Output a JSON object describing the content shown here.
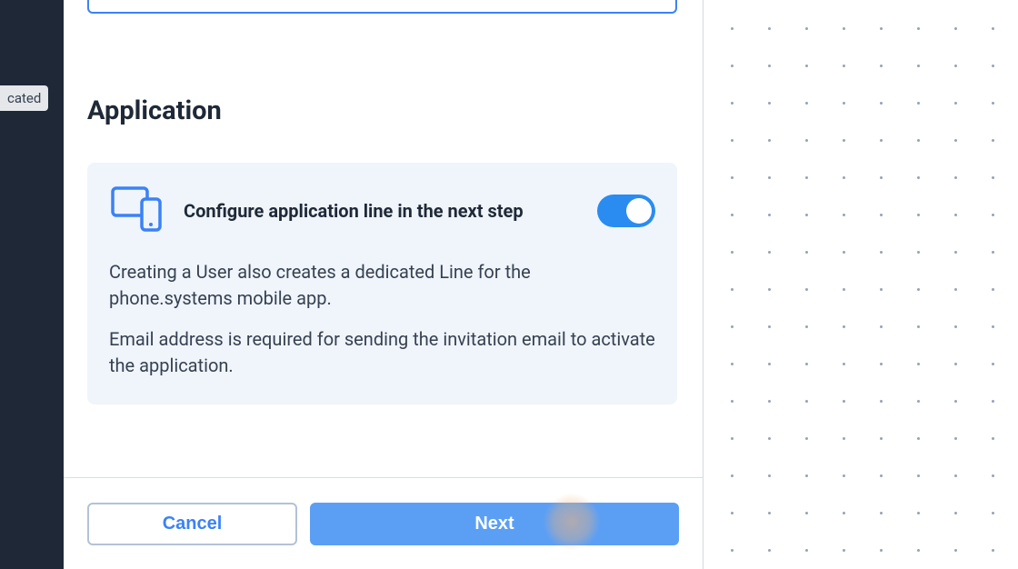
{
  "sidebar": {
    "badge_text": "cated"
  },
  "section": {
    "heading": "Application"
  },
  "card": {
    "title": "Configure application line in the next step",
    "toggle_on": true,
    "description_1": "Creating a User also creates a dedicated Line for the phone.systems mobile app.",
    "description_2": "Email address is required for sending the invitation email to activate the application."
  },
  "footer": {
    "cancel_label": "Cancel",
    "next_label": "Next"
  }
}
